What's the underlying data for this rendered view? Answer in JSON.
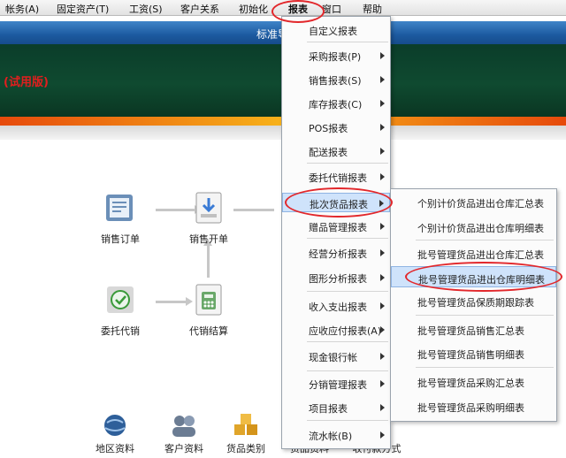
{
  "menubar": {
    "items": [
      "帐务(A)",
      "固定资产(T)",
      "工资(S)",
      "客户关系",
      "初始化",
      "报表",
      "窗口",
      "帮助"
    ]
  },
  "nav": {
    "title": "标准导航图"
  },
  "banner": {
    "trial_label": "(试用版)"
  },
  "workflow": {
    "nodes": [
      "销售订单",
      "销售开单",
      "销",
      "委托代销",
      "代销结算",
      "销"
    ]
  },
  "bottom": {
    "items": [
      "地区资料",
      "客户资料",
      "货品类别",
      "货品资料",
      "收付款方式"
    ]
  },
  "report_menu": {
    "items": [
      {
        "label": "自定义报表",
        "sub": false
      },
      {
        "label": "采购报表(P)",
        "sub": true
      },
      {
        "label": "销售报表(S)",
        "sub": true
      },
      {
        "label": "库存报表(C)",
        "sub": true
      },
      {
        "label": "POS报表",
        "sub": true
      },
      {
        "label": "配送报表",
        "sub": true
      },
      {
        "label": "委托代销报表",
        "sub": true
      },
      {
        "label": "批次货品报表",
        "sub": true
      },
      {
        "label": "赠品管理报表",
        "sub": true
      },
      {
        "label": "经营分析报表",
        "sub": true
      },
      {
        "label": "图形分析报表",
        "sub": true
      },
      {
        "label": "收入支出报表",
        "sub": true
      },
      {
        "label": "应收应付报表(A)",
        "sub": true
      },
      {
        "label": "现金银行帐",
        "sub": true
      },
      {
        "label": "分销管理报表",
        "sub": true
      },
      {
        "label": "项目报表",
        "sub": true
      },
      {
        "label": "流水帐(B)",
        "sub": true
      }
    ]
  },
  "batch_submenu": {
    "items": [
      "个别计价货品进出仓库汇总表",
      "个别计价货品进出仓库明细表",
      "批号管理货品进出仓库汇总表",
      "批号管理货品进出仓库明细表",
      "批号管理货品保质期跟踪表",
      "批号管理货品销售汇总表",
      "批号管理货品销售明细表",
      "批号管理货品采购汇总表",
      "批号管理货品采购明细表"
    ]
  },
  "colors": {
    "accent_blue": "#1c5aa0",
    "banner_green": "#0f4a30",
    "highlight": "#cfe3fb",
    "annotation_red": "#e2272b"
  }
}
